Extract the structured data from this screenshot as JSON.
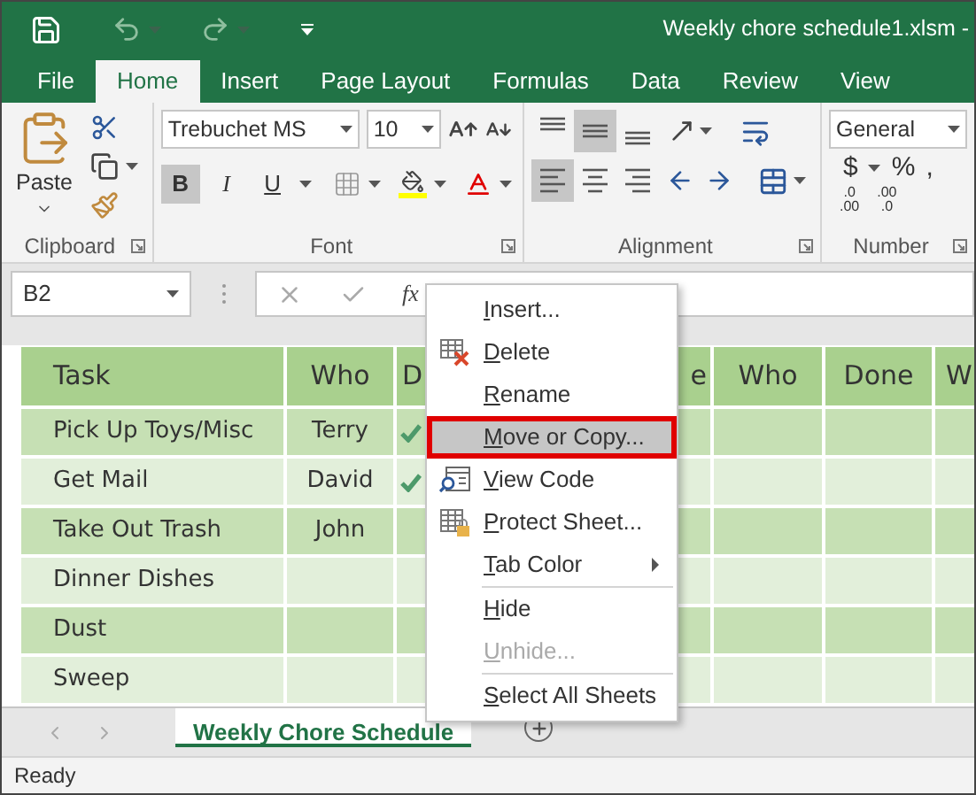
{
  "title_bar": {
    "title": "Weekly chore schedule1.xlsm -"
  },
  "ribbon_tabs": [
    {
      "label": "File",
      "selected": false
    },
    {
      "label": "Home",
      "selected": true
    },
    {
      "label": "Insert",
      "selected": false
    },
    {
      "label": "Page Layout",
      "selected": false
    },
    {
      "label": "Formulas",
      "selected": false
    },
    {
      "label": "Data",
      "selected": false
    },
    {
      "label": "Review",
      "selected": false
    },
    {
      "label": "View",
      "selected": false
    }
  ],
  "ribbon": {
    "clipboard": {
      "paste_label": "Paste",
      "group_label": "Clipboard"
    },
    "font": {
      "font_name": "Trebuchet MS",
      "font_size": "10",
      "styles": [
        {
          "label": "B",
          "selected": true
        },
        {
          "label": "I",
          "selected": false
        },
        {
          "label": "U",
          "selected": false
        }
      ],
      "group_label": "Font"
    },
    "alignment": {
      "vertical": [
        {
          "kind": "top",
          "selected": false
        },
        {
          "kind": "middle",
          "selected": true
        },
        {
          "kind": "bottom",
          "selected": false
        }
      ],
      "horizontal": [
        {
          "kind": "left",
          "selected": true
        },
        {
          "kind": "center",
          "selected": false
        },
        {
          "kind": "right",
          "selected": false
        }
      ],
      "group_label": "Alignment"
    },
    "number": {
      "format": "General",
      "symbols": [
        "$",
        "%",
        ","
      ],
      "decimal_buttons": [
        {
          "top": ".0",
          "bottom": ".00"
        },
        {
          "top": ".00",
          "bottom": ".0"
        }
      ],
      "group_label": "Number"
    }
  },
  "formula_bar": {
    "name_box": "B2",
    "function_label": "fx"
  },
  "sheet": {
    "columns": [
      "Task",
      "Who",
      "D",
      "e",
      "Who",
      "Done",
      "W"
    ],
    "rows": [
      {
        "task": "Pick Up Toys/Misc",
        "who": "Terry",
        "done": true
      },
      {
        "task": "Get Mail",
        "who": "David",
        "done": true
      },
      {
        "task": "Take Out Trash",
        "who": "John",
        "done": false
      },
      {
        "task": "Dinner Dishes",
        "who": "",
        "done": false
      },
      {
        "task": "Dust",
        "who": "",
        "done": false
      },
      {
        "task": "Sweep",
        "who": "",
        "done": false
      }
    ]
  },
  "context_menu": {
    "items": [
      {
        "kind": "plain",
        "label": "Insert...",
        "selected": false,
        "disabled": false
      },
      {
        "kind": "delete",
        "label": "Delete",
        "selected": false,
        "disabled": false
      },
      {
        "kind": "plain",
        "label": "Rename",
        "selected": false,
        "disabled": false
      },
      {
        "kind": "plain",
        "label": "Move or Copy...",
        "selected": true,
        "disabled": false
      },
      {
        "kind": "view_code",
        "label": "View Code",
        "selected": false,
        "disabled": false
      },
      {
        "kind": "protect",
        "label": "Protect Sheet...",
        "selected": false,
        "disabled": false
      },
      {
        "kind": "submenu",
        "label": "Tab Color",
        "selected": false,
        "disabled": false
      },
      {
        "kind": "separator"
      },
      {
        "kind": "plain",
        "label": "Hide",
        "selected": false,
        "disabled": false
      },
      {
        "kind": "plain",
        "label": "Unhide...",
        "selected": false,
        "disabled": true
      },
      {
        "kind": "separator"
      },
      {
        "kind": "plain",
        "label": "Select All Sheets",
        "selected": false,
        "disabled": false
      }
    ]
  },
  "sheet_tabs": [
    {
      "label": "Weekly Chore Schedule",
      "selected": true
    }
  ],
  "status_bar": {
    "text": "Ready"
  }
}
